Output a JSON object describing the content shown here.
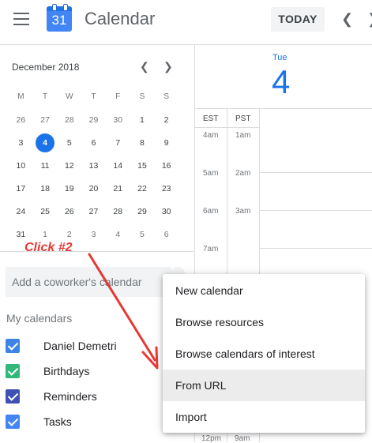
{
  "header": {
    "app_title": "Calendar",
    "logo_number": "31",
    "today_label": "TODAY",
    "prev_icon": "chevron-left-icon",
    "next_icon": "chevron-right-icon"
  },
  "mini_calendar": {
    "title": "December 2018",
    "weekdays": [
      "M",
      "T",
      "W",
      "T",
      "F",
      "S",
      "S"
    ],
    "weeks": [
      [
        "26",
        "27",
        "28",
        "29",
        "30",
        "1",
        "2"
      ],
      [
        "3",
        "4",
        "5",
        "6",
        "7",
        "8",
        "9"
      ],
      [
        "10",
        "11",
        "12",
        "13",
        "14",
        "15",
        "16"
      ],
      [
        "17",
        "18",
        "19",
        "20",
        "21",
        "22",
        "23"
      ],
      [
        "24",
        "25",
        "26",
        "27",
        "28",
        "29",
        "30"
      ],
      [
        "31",
        "1",
        "2",
        "3",
        "4",
        "5",
        "6"
      ]
    ],
    "selected_day": "4"
  },
  "annotation": "Click #2",
  "sidebar": {
    "coworker_placeholder": "Add a coworker's calendar",
    "my_calendars_label": "My calendars",
    "calendars": [
      {
        "label": "Daniel Demetri",
        "color": "#3f84e5"
      },
      {
        "label": "Birthdays",
        "color": "#33b679"
      },
      {
        "label": "Reminders",
        "color": "#3f51b5"
      },
      {
        "label": "Tasks",
        "color": "#4285f4"
      }
    ]
  },
  "day_view": {
    "day_name": "Tue",
    "day_number": "4",
    "timezones": [
      "EST",
      "PST"
    ],
    "est_times": [
      "4am",
      "5am",
      "6am",
      "7am",
      "12pm"
    ],
    "pst_times": [
      "1am",
      "2am",
      "3am",
      "9am"
    ]
  },
  "menu": {
    "items": [
      "New calendar",
      "Browse resources",
      "Browse calendars of interest",
      "From URL",
      "Import"
    ],
    "highlighted": "From URL"
  },
  "colors": {
    "accent": "#1a73e8",
    "annotation": "#e53935"
  }
}
